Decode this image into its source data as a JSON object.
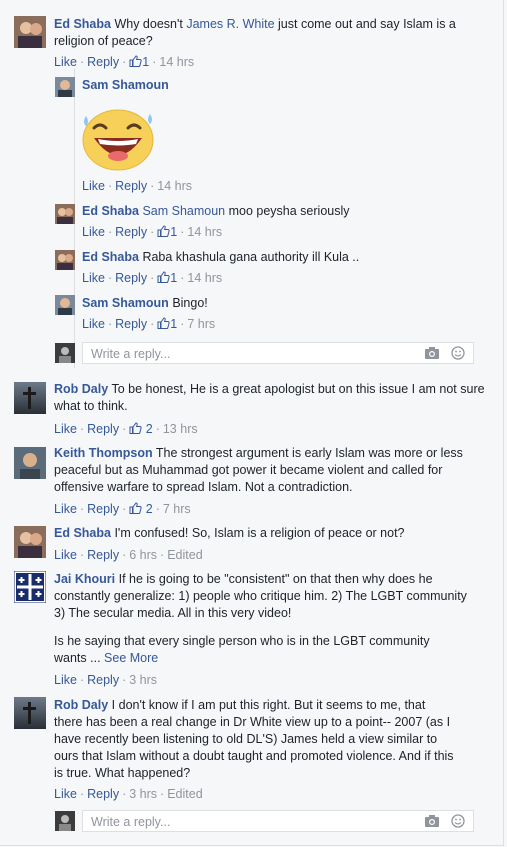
{
  "colors": {
    "link": "#365899",
    "meta": "#90949c",
    "text": "#1d2129",
    "background": "#f6f7f9"
  },
  "comments": [
    {
      "author": "Ed Shaba",
      "text_before": "Why doesn't ",
      "mention": "James R. White",
      "text_after": " just come out and say Islam is a religion of peace?",
      "like": "Like",
      "reply": "Reply",
      "reactions": "1",
      "time": "14 hrs",
      "replies": [
        {
          "author": "Sam Shamoun",
          "text": "",
          "like": "Like",
          "reply": "Reply",
          "time": "14 hrs",
          "sticker": "laughing-emoji-sticker"
        },
        {
          "author": "Ed Shaba",
          "mention": "Sam Shamoun",
          "text": " moo peysha seriously",
          "like": "Like",
          "reply": "Reply",
          "reactions": "1",
          "time": "14 hrs"
        },
        {
          "author": "Ed Shaba",
          "text": "Raba khashula gana authority ill Kula ..",
          "like": "Like",
          "reply": "Reply",
          "reactions": "1",
          "time": "14 hrs"
        },
        {
          "author": "Sam Shamoun",
          "text": "Bingo!",
          "like": "Like",
          "reply": "Reply",
          "reactions": "1",
          "time": "7 hrs"
        }
      ],
      "reply_placeholder": "Write a reply..."
    },
    {
      "author": "Rob Daly",
      "text": "To be honest, He is a great apologist but on this issue I am not sure what to think.",
      "like": "Like",
      "reply": "Reply",
      "reactions": "2",
      "time": "13 hrs"
    },
    {
      "author": "Keith Thompson",
      "text": "The strongest argument is early Islam was more or less peaceful but as Muhammad got power it became violent and called for offensive warfare to spread Islam. Not a contradiction.",
      "like": "Like",
      "reply": "Reply",
      "reactions": "2",
      "time": "7 hrs"
    },
    {
      "author": "Ed Shaba",
      "text": "I'm confused! So, Islam is a religion of peace or not?",
      "like": "Like",
      "reply": "Reply",
      "time": "6 hrs",
      "edited": "Edited"
    },
    {
      "author": "Jai Khouri",
      "text": "If he is going to be \"consistent\" on that then why does he constantly generalize: 1) people who critique him. 2) The LGBT community 3) The secular media. All in this very video!",
      "text2": "Is he saying that every single person who is in the LGBT community wants ...",
      "see_more": "See More",
      "like": "Like",
      "reply": "Reply",
      "time": "3 hrs"
    },
    {
      "author": "Rob Daly",
      "text": "I don't know if I am put this right. But it seems to me, that there has been a real change in Dr White view up to a point-- 2007 (as I have recently been listening to old DL'S) James held a view similar to ours that Islam without a doubt taught and promoted violence. And if this is true. What happened?",
      "like": "Like",
      "reply": "Reply",
      "time": "3 hrs",
      "edited": "Edited",
      "reply_placeholder": "Write a reply..."
    }
  ]
}
